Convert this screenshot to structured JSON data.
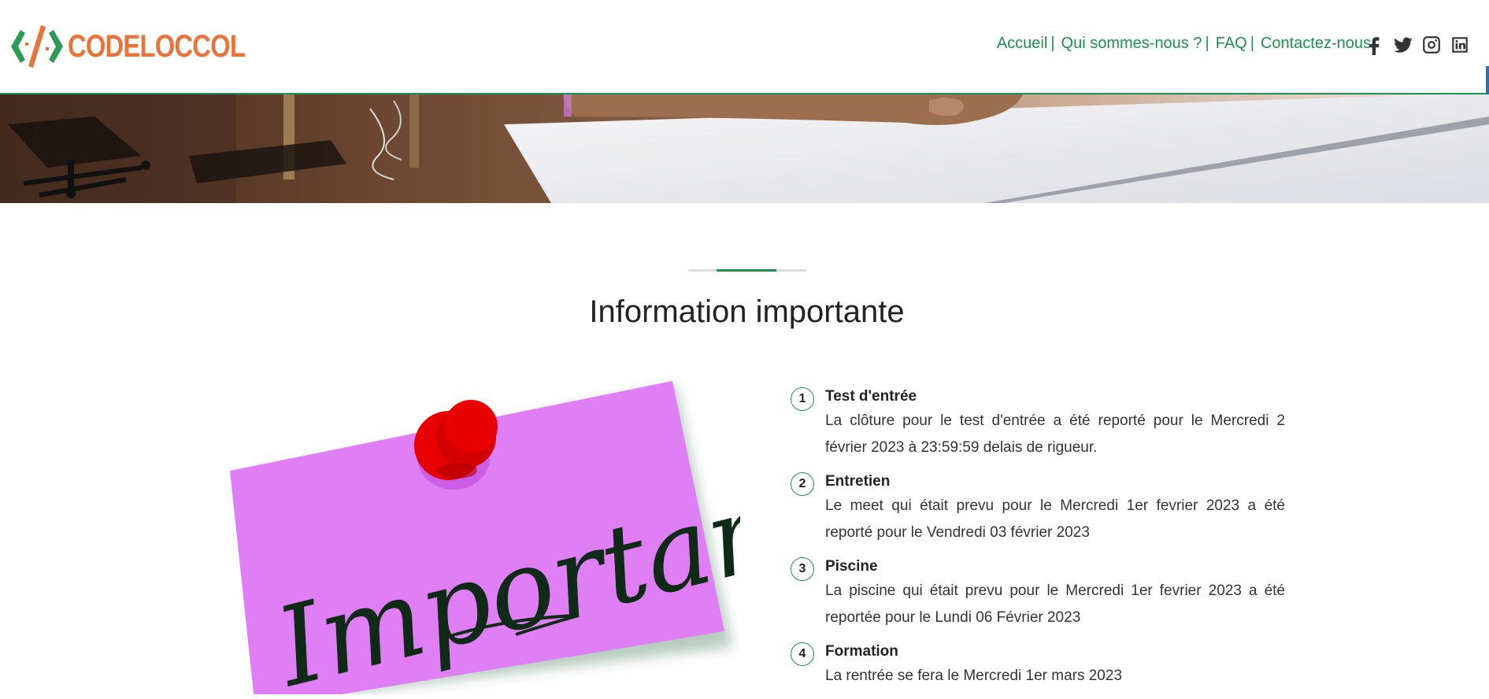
{
  "header": {
    "logo_text": "CODELOCCOL",
    "nav": [
      {
        "label": "Accueil",
        "sep": "|"
      },
      {
        "label": "Qui sommes-nous ?",
        "sep": "|"
      },
      {
        "label": "FAQ",
        "sep": "|"
      },
      {
        "label": "Contactez-nous",
        "sep": ""
      }
    ],
    "social_icons": [
      "facebook-icon",
      "twitter-icon",
      "instagram-icon",
      "linkedin-icon"
    ]
  },
  "section": {
    "title": "Information importante",
    "note_text": "Important"
  },
  "items": [
    {
      "number": "1",
      "title": "Test d'entrée",
      "text": "La clôture pour le test d'entrée a été reporté pour le Mercredi 2 février 2023 à 23:59:59 delais de rigueur."
    },
    {
      "number": "2",
      "title": "Entretien",
      "text": "Le meet qui était prevu pour le Mercredi 1er fevrier 2023 a été reporté pour le Vendredi 03 février 2023"
    },
    {
      "number": "3",
      "title": "Piscine",
      "text": "La piscine qui était prevu pour le Mercredi 1er fevrier 2023 a été reportée pour le Lundi 06 Février 2023"
    },
    {
      "number": "4",
      "title": "Formation",
      "text": "La rentrée se fera le Mercredi 1er mars 2023"
    }
  ],
  "colors": {
    "accent": "#1e8f4e",
    "logo": "#e8743b",
    "note": "#e07ff5",
    "pin": "#e80000"
  }
}
